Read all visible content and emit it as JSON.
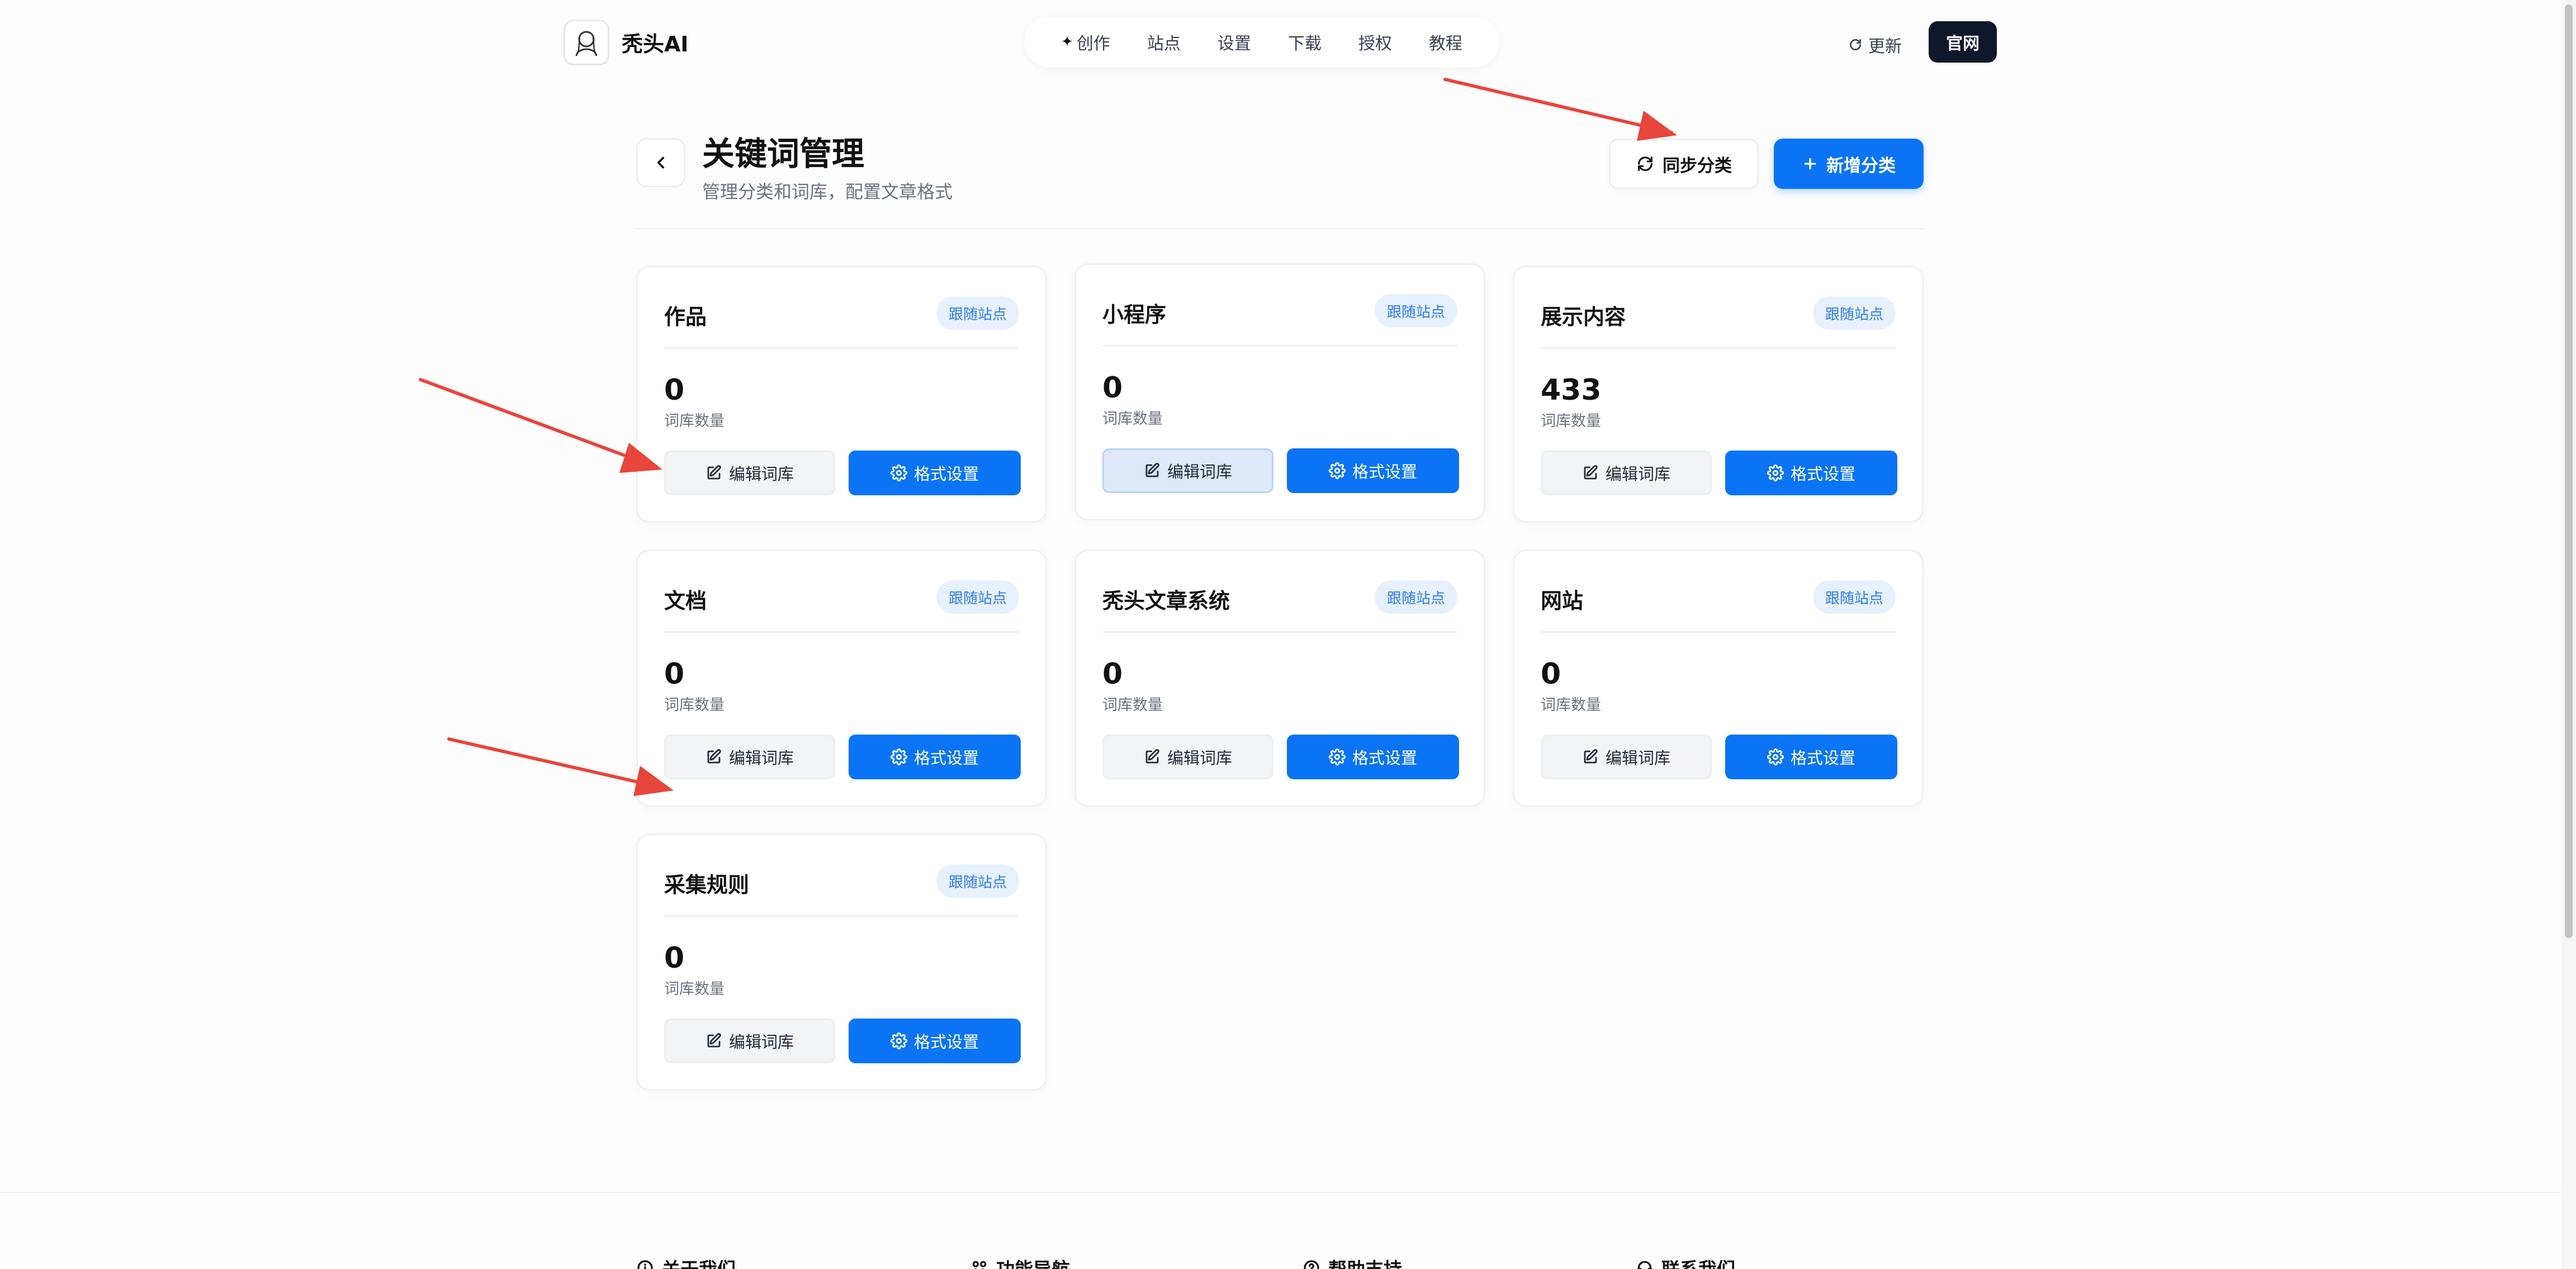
{
  "nav": {
    "brand": "秃头AI",
    "items": [
      {
        "label": "创作",
        "icon": "sparkle-icon"
      },
      {
        "label": "站点"
      },
      {
        "label": "设置"
      },
      {
        "label": "下载"
      },
      {
        "label": "授权"
      },
      {
        "label": "教程"
      }
    ],
    "update_label": "更新",
    "official_label": "官网"
  },
  "header": {
    "title": "关键词管理",
    "subtitle": "管理分类和词库，配置文章格式",
    "sync_label": "同步分类",
    "new_label": "新增分类"
  },
  "cards": [
    {
      "title": "作品",
      "badge": "跟随站点",
      "count": "0",
      "count_label": "词库数量",
      "edit_label": "编辑词库",
      "format_label": "格式设置"
    },
    {
      "title": "小程序",
      "badge": "跟随站点",
      "count": "0",
      "count_label": "词库数量",
      "edit_label": "编辑词库",
      "format_label": "格式设置"
    },
    {
      "title": "展示内容",
      "badge": "跟随站点",
      "count": "433",
      "count_label": "词库数量",
      "edit_label": "编辑词库",
      "format_label": "格式设置"
    },
    {
      "title": "文档",
      "badge": "跟随站点",
      "count": "0",
      "count_label": "词库数量",
      "edit_label": "编辑词库",
      "format_label": "格式设置"
    },
    {
      "title": "秃头文章系统",
      "badge": "跟随站点",
      "count": "0",
      "count_label": "词库数量",
      "edit_label": "编辑词库",
      "format_label": "格式设置"
    },
    {
      "title": "网站",
      "badge": "跟随站点",
      "count": "0",
      "count_label": "词库数量",
      "edit_label": "编辑词库",
      "format_label": "格式设置"
    },
    {
      "title": "采集规则",
      "badge": "跟随站点",
      "count": "0",
      "count_label": "词库数量",
      "edit_label": "编辑词库",
      "format_label": "格式设置"
    }
  ],
  "footer": {
    "columns": [
      {
        "label": "关于我们",
        "icon": "info-icon"
      },
      {
        "label": "功能导航",
        "icon": "grid-icon"
      },
      {
        "label": "帮助支持",
        "icon": "help-icon"
      },
      {
        "label": "联系我们",
        "icon": "headset-icon"
      }
    ]
  },
  "colors": {
    "primary": "#0a74f5",
    "badge_bg": "#e7f1fe",
    "badge_text": "#2b7cf0",
    "annotation_arrow": "#e8453c",
    "dark_button": "#0f172a"
  }
}
